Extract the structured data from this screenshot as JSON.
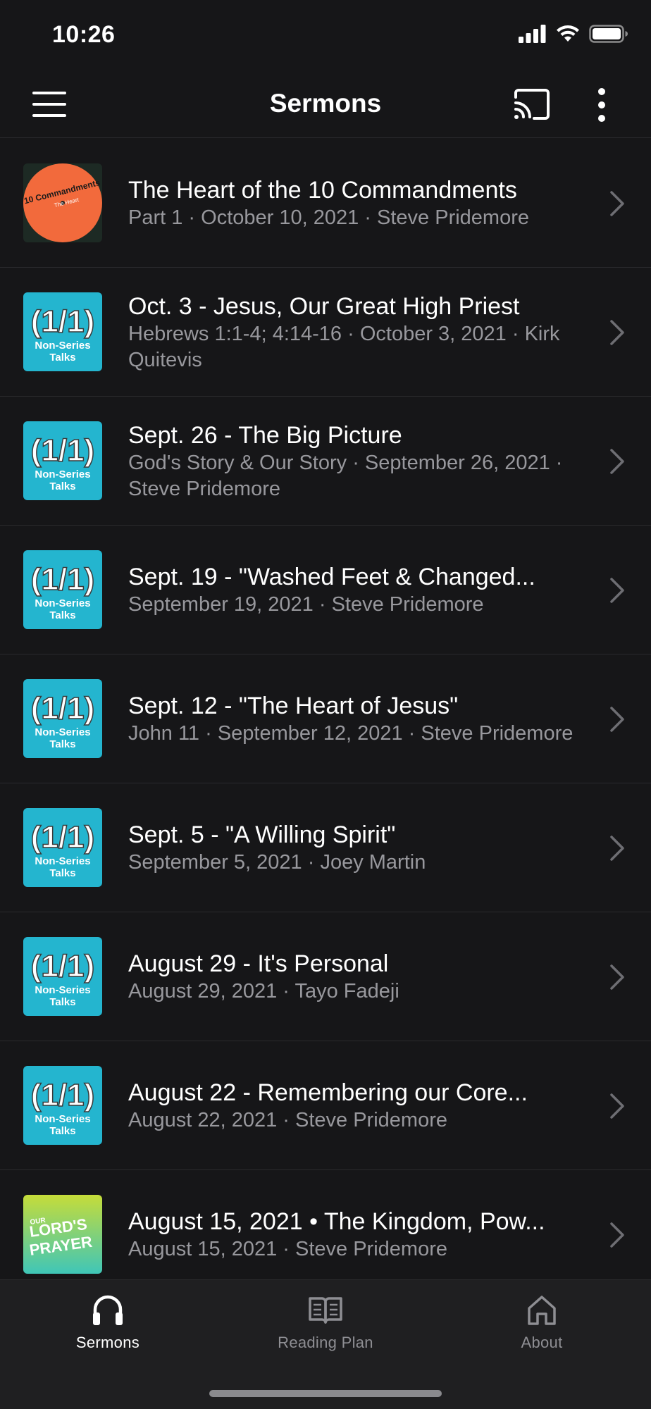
{
  "status_bar": {
    "time": "10:26"
  },
  "nav": {
    "title": "Sermons"
  },
  "sermons": [
    {
      "title": "The Heart of the 10 Commandments",
      "subtitle": "Part 1 · October 10, 2021 · Steve Pridemore",
      "art": "10-commandments",
      "art_text": "10 Commandments",
      "art_sub": "The Heart"
    },
    {
      "title": "Oct. 3 - Jesus, Our Great High Priest",
      "subtitle": "Hebrews 1:1-4; 4:14-16 · October 3, 2021 · Kirk Quitevis",
      "art": "non-series",
      "art_text": "(1/1)",
      "art_sub": "Non-Series Talks"
    },
    {
      "title": "Sept. 26 - The Big Picture",
      "subtitle": "God's Story & Our Story · September 26, 2021 · Steve Pridemore",
      "art": "non-series",
      "art_text": "(1/1)",
      "art_sub": "Non-Series Talks"
    },
    {
      "title": "Sept. 19 - \"Washed Feet & Changed...",
      "subtitle": "September 19, 2021 · Steve Pridemore",
      "art": "non-series",
      "art_text": "(1/1)",
      "art_sub": "Non-Series Talks"
    },
    {
      "title": "Sept. 12 - \"The Heart of Jesus\"",
      "subtitle": "John 11 · September 12, 2021 · Steve Pridemore",
      "art": "non-series",
      "art_text": "(1/1)",
      "art_sub": "Non-Series Talks"
    },
    {
      "title": "Sept. 5 - \"A Willing Spirit\"",
      "subtitle": "September 5, 2021 · Joey Martin",
      "art": "non-series",
      "art_text": "(1/1)",
      "art_sub": "Non-Series Talks"
    },
    {
      "title": "August 29 - It's Personal",
      "subtitle": "August 29, 2021 · Tayo Fadeji",
      "art": "non-series",
      "art_text": "(1/1)",
      "art_sub": "Non-Series Talks"
    },
    {
      "title": "August 22 - Remembering our Core...",
      "subtitle": "August 22, 2021 · Steve Pridemore",
      "art": "non-series",
      "art_text": "(1/1)",
      "art_sub": "Non-Series Talks"
    },
    {
      "title": "August 15, 2021 • The Kingdom, Pow...",
      "subtitle": "August 15, 2021 · Steve Pridemore",
      "art": "lords-prayer",
      "art_text": "LORD'S PRAYER",
      "art_sub": "OUR"
    }
  ],
  "tabs": [
    {
      "label": "Sermons",
      "icon": "headphones-icon",
      "active": true
    },
    {
      "label": "Reading Plan",
      "icon": "book-icon",
      "active": false
    },
    {
      "label": "About",
      "icon": "home-icon",
      "active": false
    }
  ],
  "colors": {
    "background": "#161618",
    "non_series_art": "#24b5cf",
    "commandments_art": "#f26a3c",
    "lords_prayer_top": "#c6dc39",
    "lords_prayer_bottom": "#3fc6b8",
    "subtitle_text": "#98989d"
  }
}
